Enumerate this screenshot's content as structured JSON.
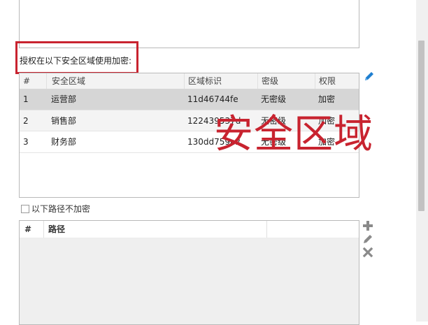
{
  "authorized_section": {
    "label": "授权在以下安全区域使用加密:"
  },
  "zone_table": {
    "columns": [
      "#",
      "安全区域",
      "区域标识",
      "密级",
      "权限"
    ],
    "rows": [
      [
        "1",
        "运营部",
        "11d46744fe",
        "无密级",
        "加密"
      ],
      [
        "2",
        "销售部",
        "122439537d",
        "无密级",
        "加密"
      ],
      [
        "3",
        "财务部",
        "130dd759a2",
        "无密级",
        "加密"
      ]
    ]
  },
  "watermark": {
    "text": "安全区域"
  },
  "exclude_paths": {
    "checkbox_label": "以下路径不加密",
    "checked": false
  },
  "path_table": {
    "columns": [
      "#",
      "路径",
      ""
    ]
  },
  "icons": {
    "edit": "pencil-icon",
    "add": "plus-icon",
    "delete": "x-icon"
  },
  "colors": {
    "accent": "#1f7fd0",
    "highlight": "#c8232f",
    "selected_row": "#d6d6d6"
  }
}
